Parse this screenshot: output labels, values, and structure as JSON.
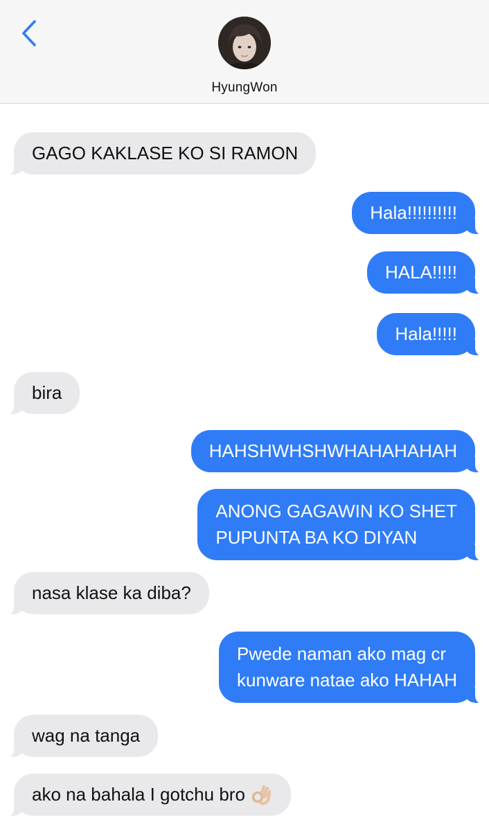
{
  "header": {
    "back_icon": "chevron-left-icon",
    "contact_name": "HyungWon",
    "avatar_icon": "contact-avatar-photo",
    "accent_color": "#2f7cf6"
  },
  "messages": [
    {
      "direction": "received",
      "lines": [
        "GAGO KAKLASE KO SI RAMON"
      ]
    },
    {
      "direction": "sent",
      "lines": [
        "Hala!!!!!!!!!!"
      ]
    },
    {
      "direction": "sent",
      "lines": [
        "HALA!!!!!"
      ]
    },
    {
      "direction": "sent",
      "lines": [
        "Hala!!!!!"
      ]
    },
    {
      "direction": "received",
      "lines": [
        "bira"
      ]
    },
    {
      "direction": "sent",
      "lines": [
        "HAHSHWHSHWHAHAHAHAH"
      ]
    },
    {
      "direction": "sent",
      "lines": [
        "ANONG GAGAWIN KO SHET",
        "PUPUNTA BA KO DIYAN"
      ]
    },
    {
      "direction": "received",
      "lines": [
        "nasa klase ka diba?"
      ]
    },
    {
      "direction": "sent",
      "lines": [
        "Pwede naman ako mag cr",
        "kunware natae ako HAHAH"
      ]
    },
    {
      "direction": "received",
      "lines": [
        "wag na tanga"
      ]
    },
    {
      "direction": "received",
      "lines": [
        "ako na bahala I gotchu bro"
      ],
      "emoji": "ok-hand-emoji"
    }
  ],
  "colors": {
    "sent_bubble": "#2f7cf6",
    "received_bubble": "#e9e9eb",
    "header_bg": "#f6f6f6"
  }
}
